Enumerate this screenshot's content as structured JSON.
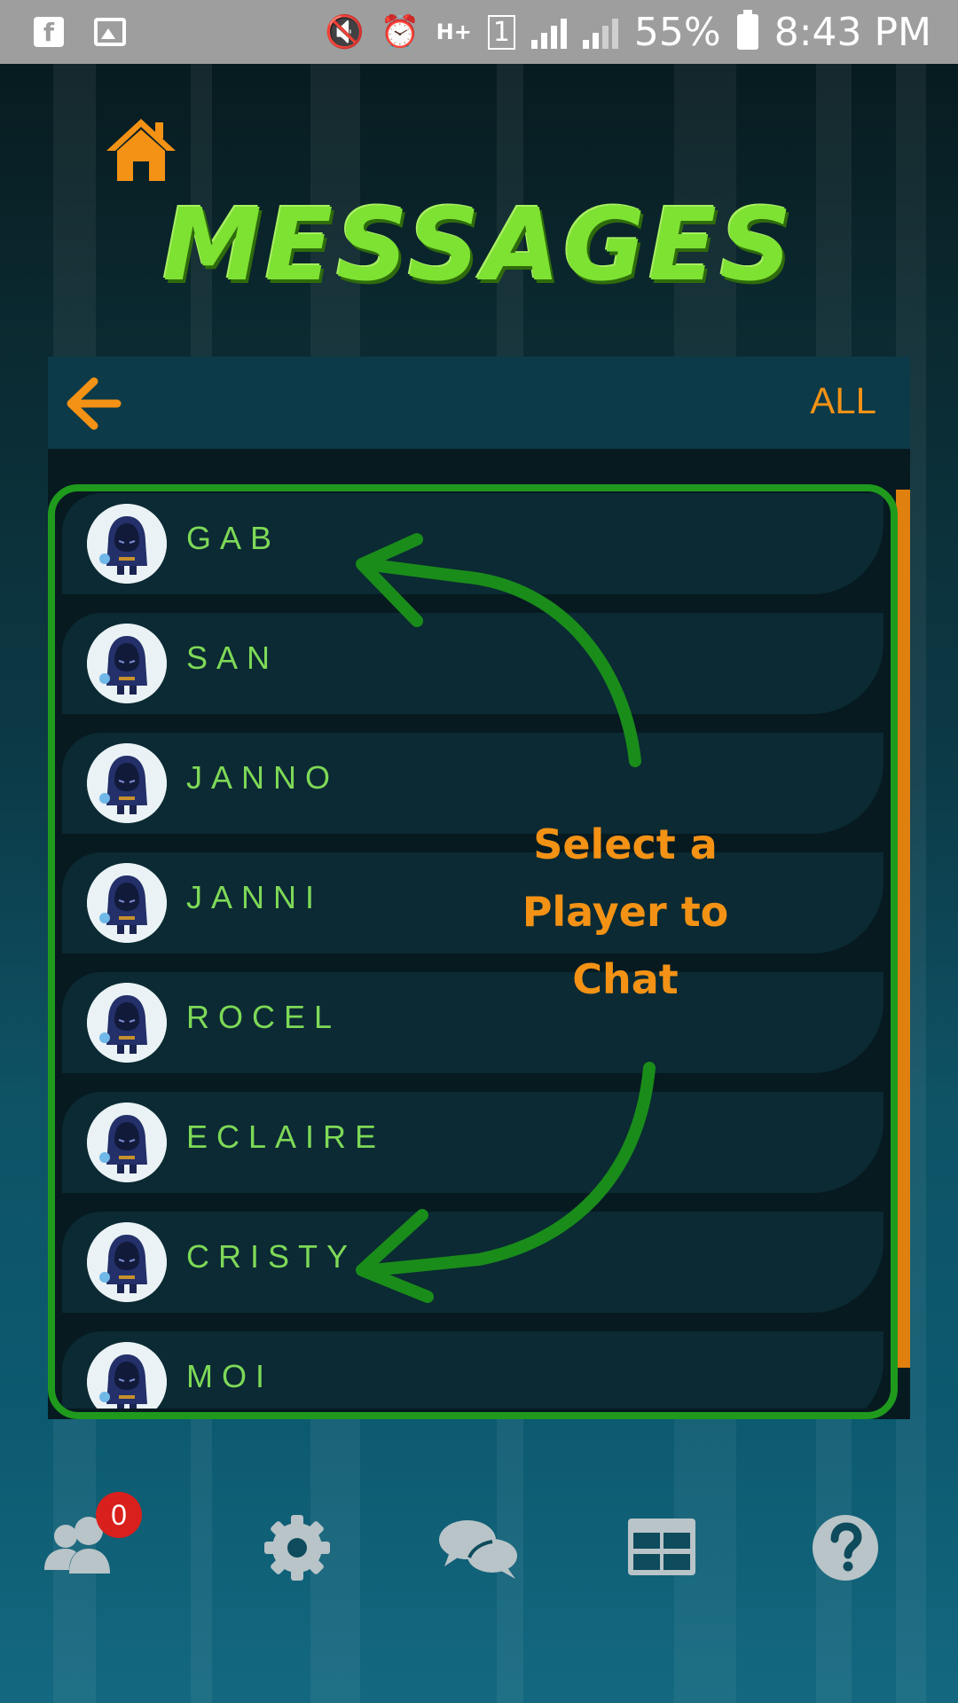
{
  "status_bar": {
    "battery": "55%",
    "time": "8:43 PM",
    "network": "H+",
    "sim": "1"
  },
  "header": {
    "title": "MESSAGES"
  },
  "panel": {
    "filter_label": "ALL"
  },
  "players": [
    {
      "name": "GAB"
    },
    {
      "name": "SAN"
    },
    {
      "name": "JANNO"
    },
    {
      "name": "JANNI"
    },
    {
      "name": "ROCEL"
    },
    {
      "name": "ECLAIRE"
    },
    {
      "name": "CRISTY"
    },
    {
      "name": "MOI"
    }
  ],
  "annotation": {
    "line1": "Select a",
    "line2": "Player to",
    "line3": "Chat"
  },
  "bottom_nav": {
    "friends_badge": "0",
    "items": [
      "friends-icon",
      "settings-icon",
      "chat-icon",
      "leaderboard-icon",
      "help-icon"
    ]
  },
  "colors": {
    "title_green": "#7de232",
    "accent_orange": "#f39215",
    "name_green": "#7ed957",
    "highlight_green": "#1f9a1d",
    "badge_red": "#d9201c"
  }
}
